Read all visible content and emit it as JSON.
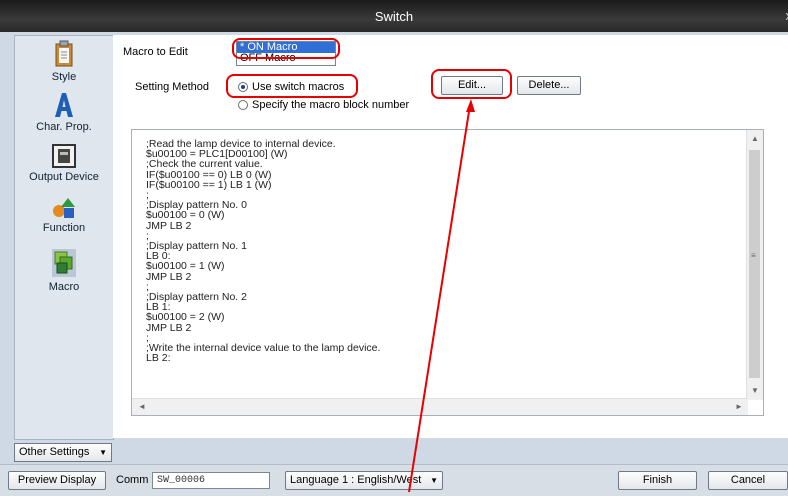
{
  "window": {
    "title": "Switch",
    "close_glyph": "x"
  },
  "sidebar": {
    "items": [
      {
        "label": "Style",
        "icon": "clipboard-icon"
      },
      {
        "label": "Char. Prop.",
        "icon": "letter-a-icon"
      },
      {
        "label": "Output Device",
        "icon": "lamp-device-icon"
      },
      {
        "label": "Function",
        "icon": "shapes-icon"
      },
      {
        "label": "Macro",
        "icon": "macro-blocks-icon"
      }
    ],
    "other_settings": "Other Settings"
  },
  "form": {
    "macro_to_edit_label": "Macro to Edit",
    "macro_options": [
      "* ON Macro",
      "OFF Macro"
    ],
    "setting_method_label": "Setting Method",
    "radio_use_switch": "Use switch macros",
    "radio_specify_block": "Specify the macro block number",
    "edit_button": "Edit...",
    "delete_button": "Delete..."
  },
  "code": {
    "lines": [
      ";Read the lamp device to internal device.",
      "$u00100 = PLC1[D00100] (W)",
      ";Check the current value.",
      "IF($u00100 == 0) LB 0 (W)",
      "IF($u00100 == 1) LB 1 (W)",
      ";",
      ";Display pattern No. 0",
      "$u00100 = 0 (W)",
      "JMP LB 2",
      ";",
      ";Display pattern No. 1",
      "LB 0:",
      "$u00100 = 1 (W)",
      "JMP LB 2",
      ";",
      ";Display pattern No. 2",
      "LB 1:",
      "$u00100 = 2 (W)",
      "JMP LB 2",
      ";",
      ";Write the internal device value to the lamp device.",
      "LB 2:"
    ]
  },
  "bottom": {
    "preview_display": "Preview Display",
    "comm_label": "Comm",
    "comm_value": "SW_00006",
    "language": "Language 1 : English/West",
    "finish": "Finish",
    "cancel": "Cancel"
  },
  "colors": {
    "highlight_ring": "#e60000",
    "selection": "#2f6fd6",
    "titlebar": "#2a2a2a"
  }
}
